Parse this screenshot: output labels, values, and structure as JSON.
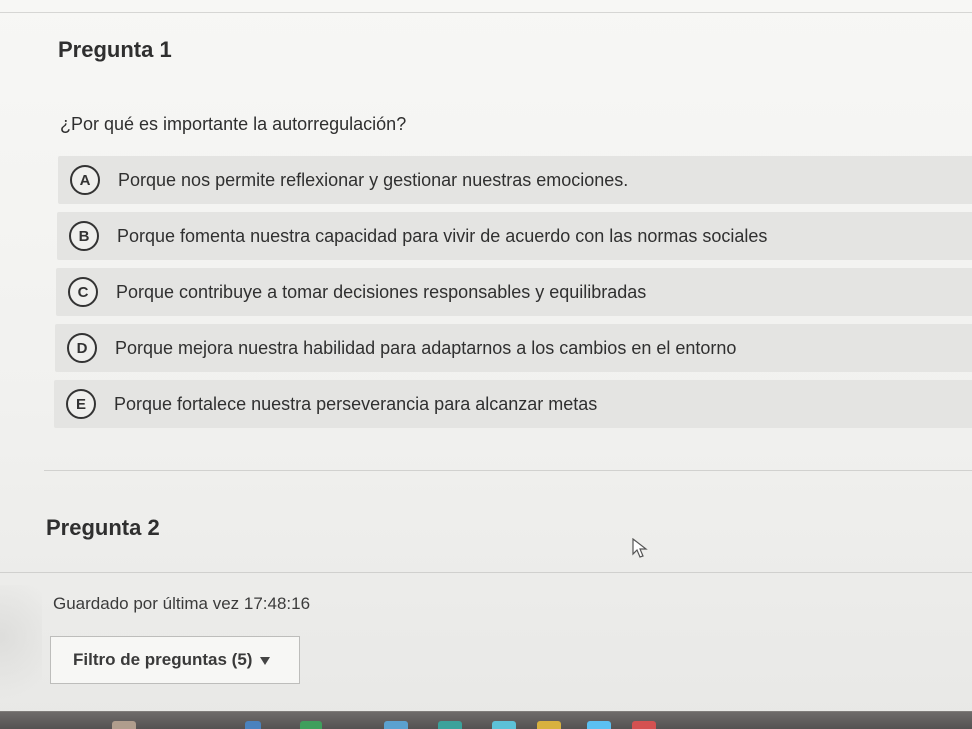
{
  "question_1": {
    "title": "Pregunta 1",
    "prompt": "¿Por qué es importante la autorregulación?",
    "options": [
      {
        "letter": "A",
        "text": "Porque nos permite reflexionar y gestionar nuestras emociones."
      },
      {
        "letter": "B",
        "text": "Porque fomenta nuestra capacidad para vivir de acuerdo con las normas sociales"
      },
      {
        "letter": "C",
        "text": "Porque contribuye a tomar decisiones responsables y equilibradas"
      },
      {
        "letter": "D",
        "text": "Porque mejora nuestra habilidad para adaptarnos a los cambios en el entorno"
      },
      {
        "letter": "E",
        "text": "Porque fortalece nuestra perseverancia para alcanzar metas"
      }
    ]
  },
  "question_2": {
    "title": "Pregunta 2"
  },
  "footer": {
    "saved_status": "Guardado por última vez 17:48:16",
    "filter_label": "Filtro de preguntas (5)",
    "filter_icon": "dropdown-arrow-icon"
  },
  "colors": {
    "background": "#f3f3f1",
    "option_background": "#e4e4e2",
    "text": "#2f2f2f",
    "taskbar": "#5f5c5b"
  },
  "icons": {
    "pointer": "mouse-pointer-icon"
  }
}
